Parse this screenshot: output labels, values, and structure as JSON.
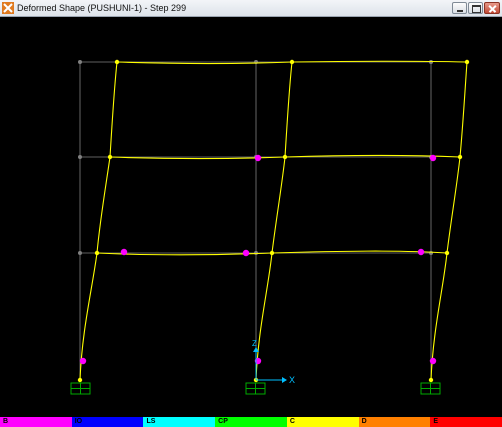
{
  "window": {
    "title": "Deformed Shape (PUSHUNI-1) - Step 299",
    "icon": "etabs-app-icon"
  },
  "plot": {
    "background": "#000000",
    "undeformed_color": "#808080",
    "deformed_color": "#ffff00",
    "hinge_color": "#ff00ff",
    "support_color": "#00aa00",
    "axis_color": "#00bfff",
    "axis_labels": {
      "x": "X",
      "z": "Z"
    }
  },
  "legend": [
    {
      "label": "B",
      "color": "#ff00ff"
    },
    {
      "label": "IO",
      "color": "#0000ff"
    },
    {
      "label": "LS",
      "color": "#00ffff"
    },
    {
      "label": "CP",
      "color": "#00ff00"
    },
    {
      "label": "C",
      "color": "#ffff00"
    },
    {
      "label": "D",
      "color": "#ff8000"
    },
    {
      "label": "E",
      "color": "#ff0000"
    }
  ]
}
